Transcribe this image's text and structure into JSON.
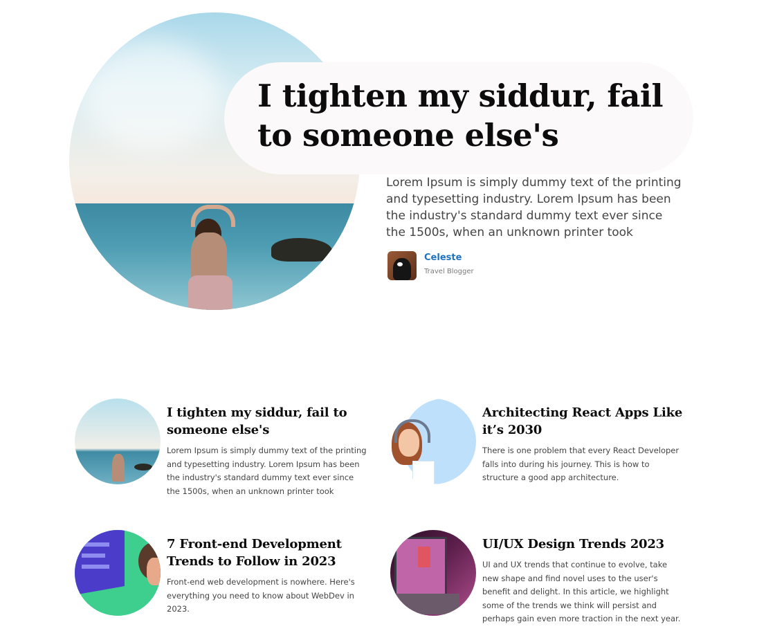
{
  "hero": {
    "title": "I tighten my siddur, fail to someone else's",
    "excerpt": "Lorem Ipsum is simply dummy text of the printing and typesetting industry. Lorem Ipsum has been the industry's standard dummy text ever since the 1500s, when an unknown printer took",
    "author": {
      "name": "Celeste",
      "role": "Travel Blogger"
    }
  },
  "cards": [
    {
      "title": "I tighten my siddur, fail to someone else's",
      "excerpt": "Lorem Ipsum is simply dummy text of the printing and typesetting industry. Lorem Ipsum has been the industry's standard dummy text ever since the 1500s, when an unknown printer took"
    },
    {
      "title": "Architecting React Apps Like it’s 2030",
      "excerpt": "There is one problem that every React Developer falls into during his journey. This is how to structure a good app architecture."
    },
    {
      "title": "7 Front-end Development Trends to Follow in 2023",
      "excerpt": "Front-end web development is nowhere. Here's everything you need to know about WebDev in 2023."
    },
    {
      "title": "UI/UX Design Trends 2023",
      "excerpt": "UI and UX trends that continue to evolve, take new shape and find novel uses to the user's benefit and delight. In this article, we highlight some of the trends we think will persist and perhaps gain even more traction in the next year."
    }
  ],
  "colors": {
    "author_link": "#1e73be",
    "title_bubble": "#fbf9f9",
    "text": "#444444"
  }
}
